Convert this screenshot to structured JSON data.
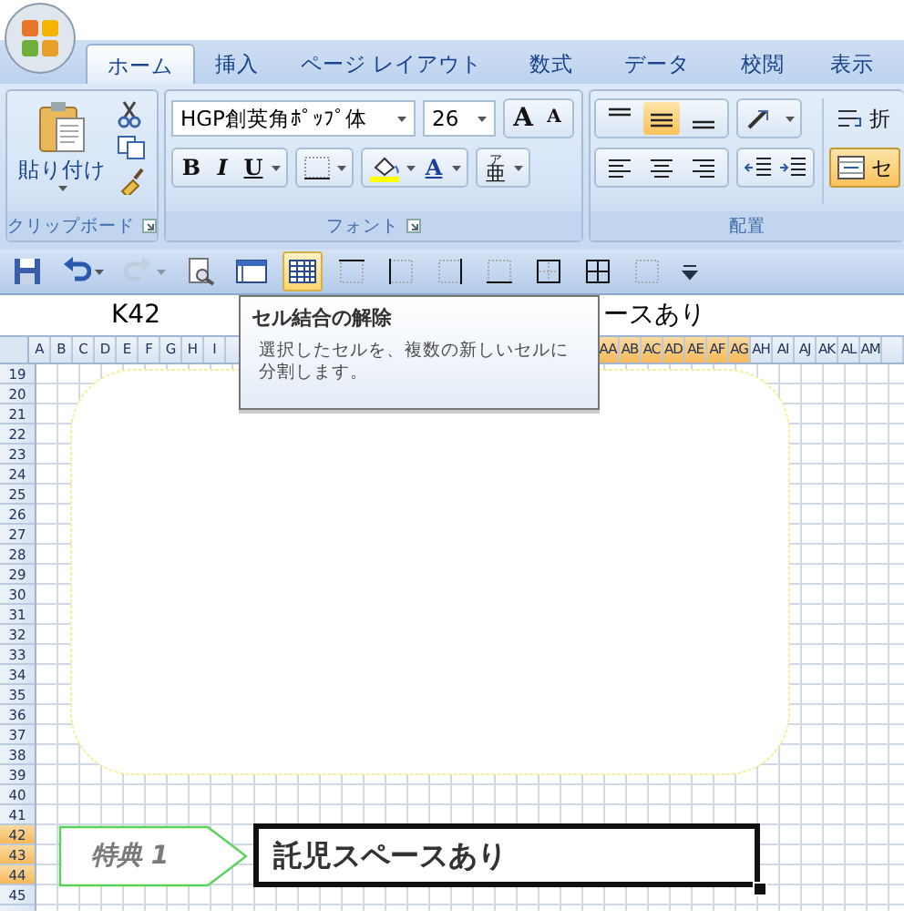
{
  "tabs": [
    {
      "label": "ホーム",
      "selected": true
    },
    {
      "label": "挿入",
      "selected": false
    },
    {
      "label": "ページ レイアウト",
      "selected": false
    },
    {
      "label": "数式",
      "selected": false
    },
    {
      "label": "データ",
      "selected": false
    },
    {
      "label": "校閲",
      "selected": false
    },
    {
      "label": "表示",
      "selected": false
    }
  ],
  "clipboard": {
    "paste": "貼り付け",
    "label": "クリップボード"
  },
  "font": {
    "name": "HGP創英角ﾎﾟｯﾌﾟ体",
    "size": "26",
    "grow": "A",
    "shrink": "A",
    "bold": "B",
    "italic": "I",
    "underline": "U",
    "font_color": "A",
    "phonetic": "亜",
    "phonetic_ruby": "ア",
    "label": "フォント"
  },
  "alignment": {
    "vertical": [
      {
        "kind": "top",
        "selected": false
      },
      {
        "kind": "middle",
        "selected": true
      },
      {
        "kind": "bottom",
        "selected": false
      }
    ],
    "horizontal": [
      {
        "kind": "left",
        "selected": false
      },
      {
        "kind": "center",
        "selected": false
      },
      {
        "kind": "right",
        "selected": false
      }
    ],
    "wrap": "折",
    "merge": {
      "label": "セ",
      "selected": true
    },
    "label": "配置"
  },
  "quick_access": [
    {
      "kind": "save",
      "selected": false,
      "disabled": false
    },
    {
      "kind": "undo",
      "selected": false,
      "disabled": false
    },
    {
      "kind": "redo",
      "selected": false,
      "disabled": true
    },
    {
      "kind": "preview",
      "selected": false,
      "disabled": false
    },
    {
      "kind": "window",
      "selected": false,
      "disabled": false
    },
    {
      "kind": "merge",
      "selected": true,
      "disabled": false
    },
    {
      "kind": "border-top",
      "selected": false,
      "disabled": false
    },
    {
      "kind": "border-left",
      "selected": false,
      "disabled": false
    },
    {
      "kind": "border-right",
      "selected": false,
      "disabled": false
    },
    {
      "kind": "border-bottom",
      "selected": false,
      "disabled": false
    },
    {
      "kind": "border-outside",
      "selected": false,
      "disabled": false
    },
    {
      "kind": "border-all",
      "selected": false,
      "disabled": false
    },
    {
      "kind": "border-none",
      "selected": false,
      "disabled": false
    },
    {
      "kind": "customize",
      "selected": false,
      "disabled": false
    }
  ],
  "formula_bar": {
    "name_box": "K42",
    "value": "ースあり"
  },
  "tooltip": {
    "title": "セル結合の解除",
    "text": "選択したセルを、複数の新しいセルに分割します。"
  },
  "columns_left": [
    {
      "label": "A",
      "selected": false
    },
    {
      "label": "B",
      "selected": false
    },
    {
      "label": "C",
      "selected": false
    },
    {
      "label": "D",
      "selected": false
    },
    {
      "label": "E",
      "selected": false
    },
    {
      "label": "F",
      "selected": false
    },
    {
      "label": "G",
      "selected": false
    },
    {
      "label": "H",
      "selected": false
    },
    {
      "label": "I",
      "selected": false
    }
  ],
  "columns_right": [
    {
      "label": "AA",
      "selected": true
    },
    {
      "label": "AB",
      "selected": true
    },
    {
      "label": "AC",
      "selected": true
    },
    {
      "label": "AD",
      "selected": true
    },
    {
      "label": "AE",
      "selected": true
    },
    {
      "label": "AF",
      "selected": true
    },
    {
      "label": "AG",
      "selected": true
    },
    {
      "label": "AH",
      "selected": false
    },
    {
      "label": "AI",
      "selected": false
    },
    {
      "label": "AJ",
      "selected": false
    },
    {
      "label": "AK",
      "selected": false
    },
    {
      "label": "AL",
      "selected": false
    },
    {
      "label": "AM",
      "selected": false
    }
  ],
  "rows": [
    {
      "label": "19",
      "selected": false
    },
    {
      "label": "20",
      "selected": false
    },
    {
      "label": "21",
      "selected": false
    },
    {
      "label": "22",
      "selected": false
    },
    {
      "label": "23",
      "selected": false
    },
    {
      "label": "24",
      "selected": false
    },
    {
      "label": "25",
      "selected": false
    },
    {
      "label": "26",
      "selected": false
    },
    {
      "label": "27",
      "selected": false
    },
    {
      "label": "28",
      "selected": false
    },
    {
      "label": "29",
      "selected": false
    },
    {
      "label": "30",
      "selected": false
    },
    {
      "label": "31",
      "selected": false
    },
    {
      "label": "32",
      "selected": false
    },
    {
      "label": "33",
      "selected": false
    },
    {
      "label": "34",
      "selected": false
    },
    {
      "label": "35",
      "selected": false
    },
    {
      "label": "36",
      "selected": false
    },
    {
      "label": "37",
      "selected": false
    },
    {
      "label": "38",
      "selected": false
    },
    {
      "label": "39",
      "selected": false
    },
    {
      "label": "40",
      "selected": false
    },
    {
      "label": "41",
      "selected": false
    },
    {
      "label": "42",
      "selected": true
    },
    {
      "label": "43",
      "selected": true
    },
    {
      "label": "44",
      "selected": true
    },
    {
      "label": "45",
      "selected": false
    }
  ],
  "sheet": {
    "badge": "特典 1",
    "cell_text": "託児スペースあり"
  }
}
